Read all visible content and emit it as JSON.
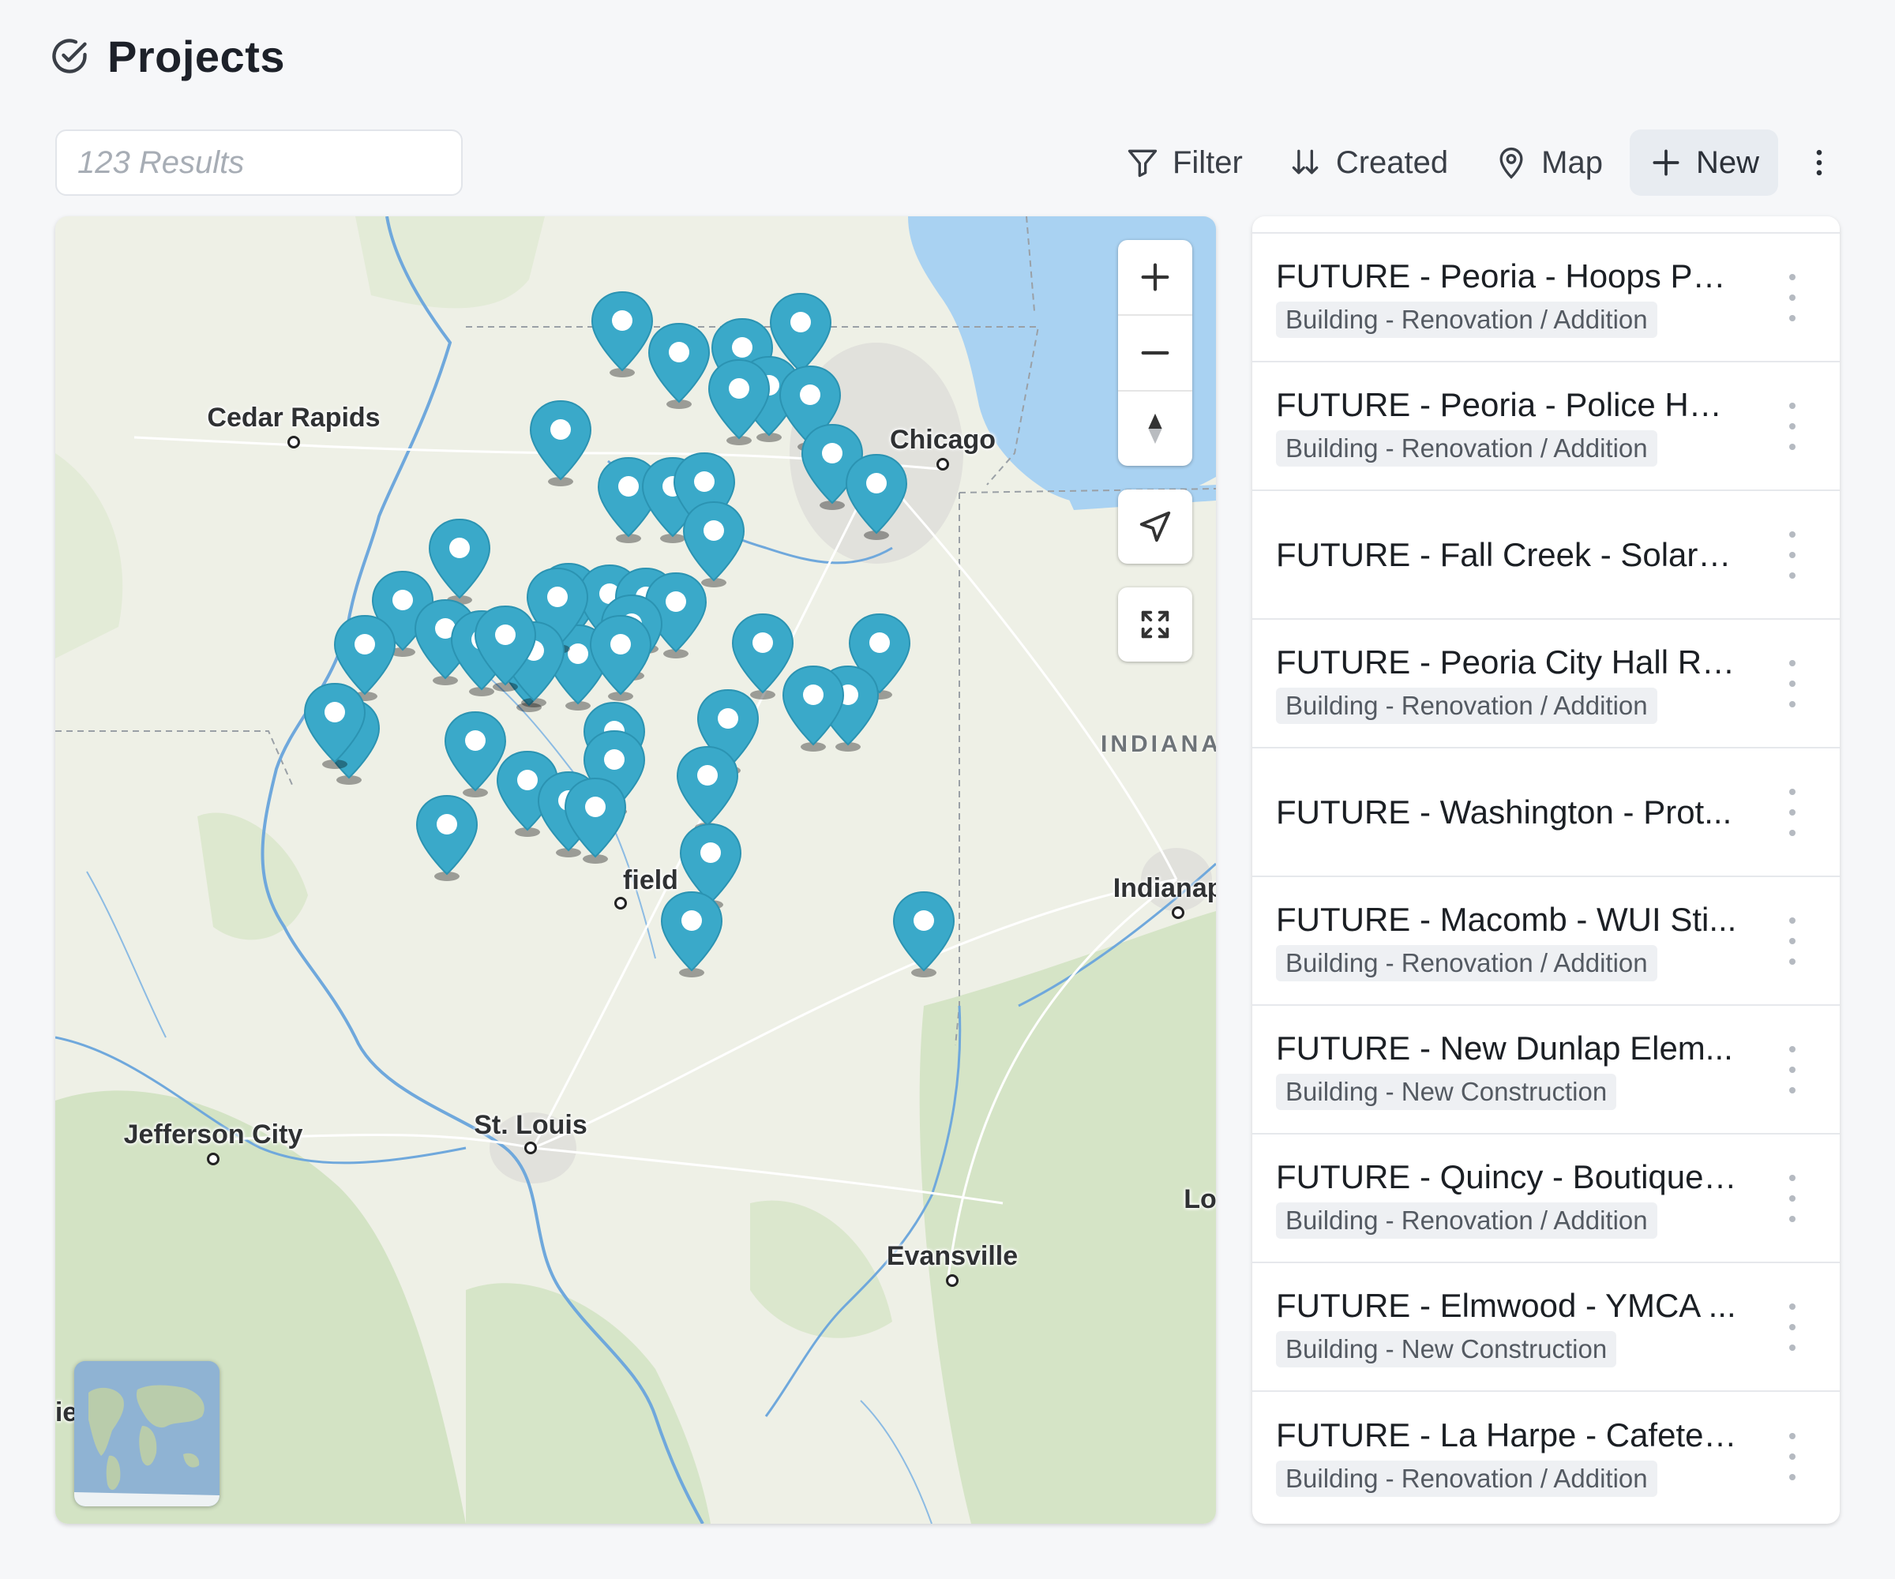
{
  "header": {
    "title": "Projects",
    "icon": "check-circle-icon"
  },
  "search": {
    "placeholder": "123 Results",
    "value": ""
  },
  "toolbar": {
    "filter_label": "Filter",
    "sort_label": "Created",
    "view_label": "Map",
    "new_label": "New"
  },
  "map": {
    "cities": {
      "cedar_rapids": "Cedar Rapids",
      "chicago": "Chicago",
      "jefferson_city": "Jefferson City",
      "st_louis": "St. Louis",
      "springfield": "field",
      "indianapolis": "Indianapo",
      "evansville": "Evansville",
      "louisville": "Lo",
      "edge_left": "ie"
    },
    "states": {
      "indiana": "INDIANA"
    },
    "colors": {
      "pin": "#3aa9c9",
      "water": "#a9d2f2",
      "land": "#eef0e6",
      "forest": "#cfe0c0"
    }
  },
  "projects": [
    {
      "title": "FUTURE - Peoria - Hoops Pu...",
      "tag": "Building - Renovation / Addition"
    },
    {
      "title": "FUTURE - Peoria - Police Hea...",
      "tag": "Building - Renovation / Addition"
    },
    {
      "title": "FUTURE - Fall Creek - Solar P...",
      "tag": ""
    },
    {
      "title": "FUTURE - Peoria City Hall Re...",
      "tag": "Building - Renovation / Addition"
    },
    {
      "title": "FUTURE - Washington - Prot...",
      "tag": ""
    },
    {
      "title": "FUTURE - Macomb - WUI Sti...",
      "tag": "Building - Renovation / Addition"
    },
    {
      "title": "FUTURE - New Dunlap Elem...",
      "tag": "Building - New Construction"
    },
    {
      "title": "FUTURE - Quincy - Boutique ...",
      "tag": "Building - Renovation / Addition"
    },
    {
      "title": "FUTURE - Elmwood - YMCA ...",
      "tag": "Building - New Construction"
    },
    {
      "title": "FUTURE - La Harpe - Cafeter...",
      "tag": "Building - Renovation / Addition"
    }
  ]
}
